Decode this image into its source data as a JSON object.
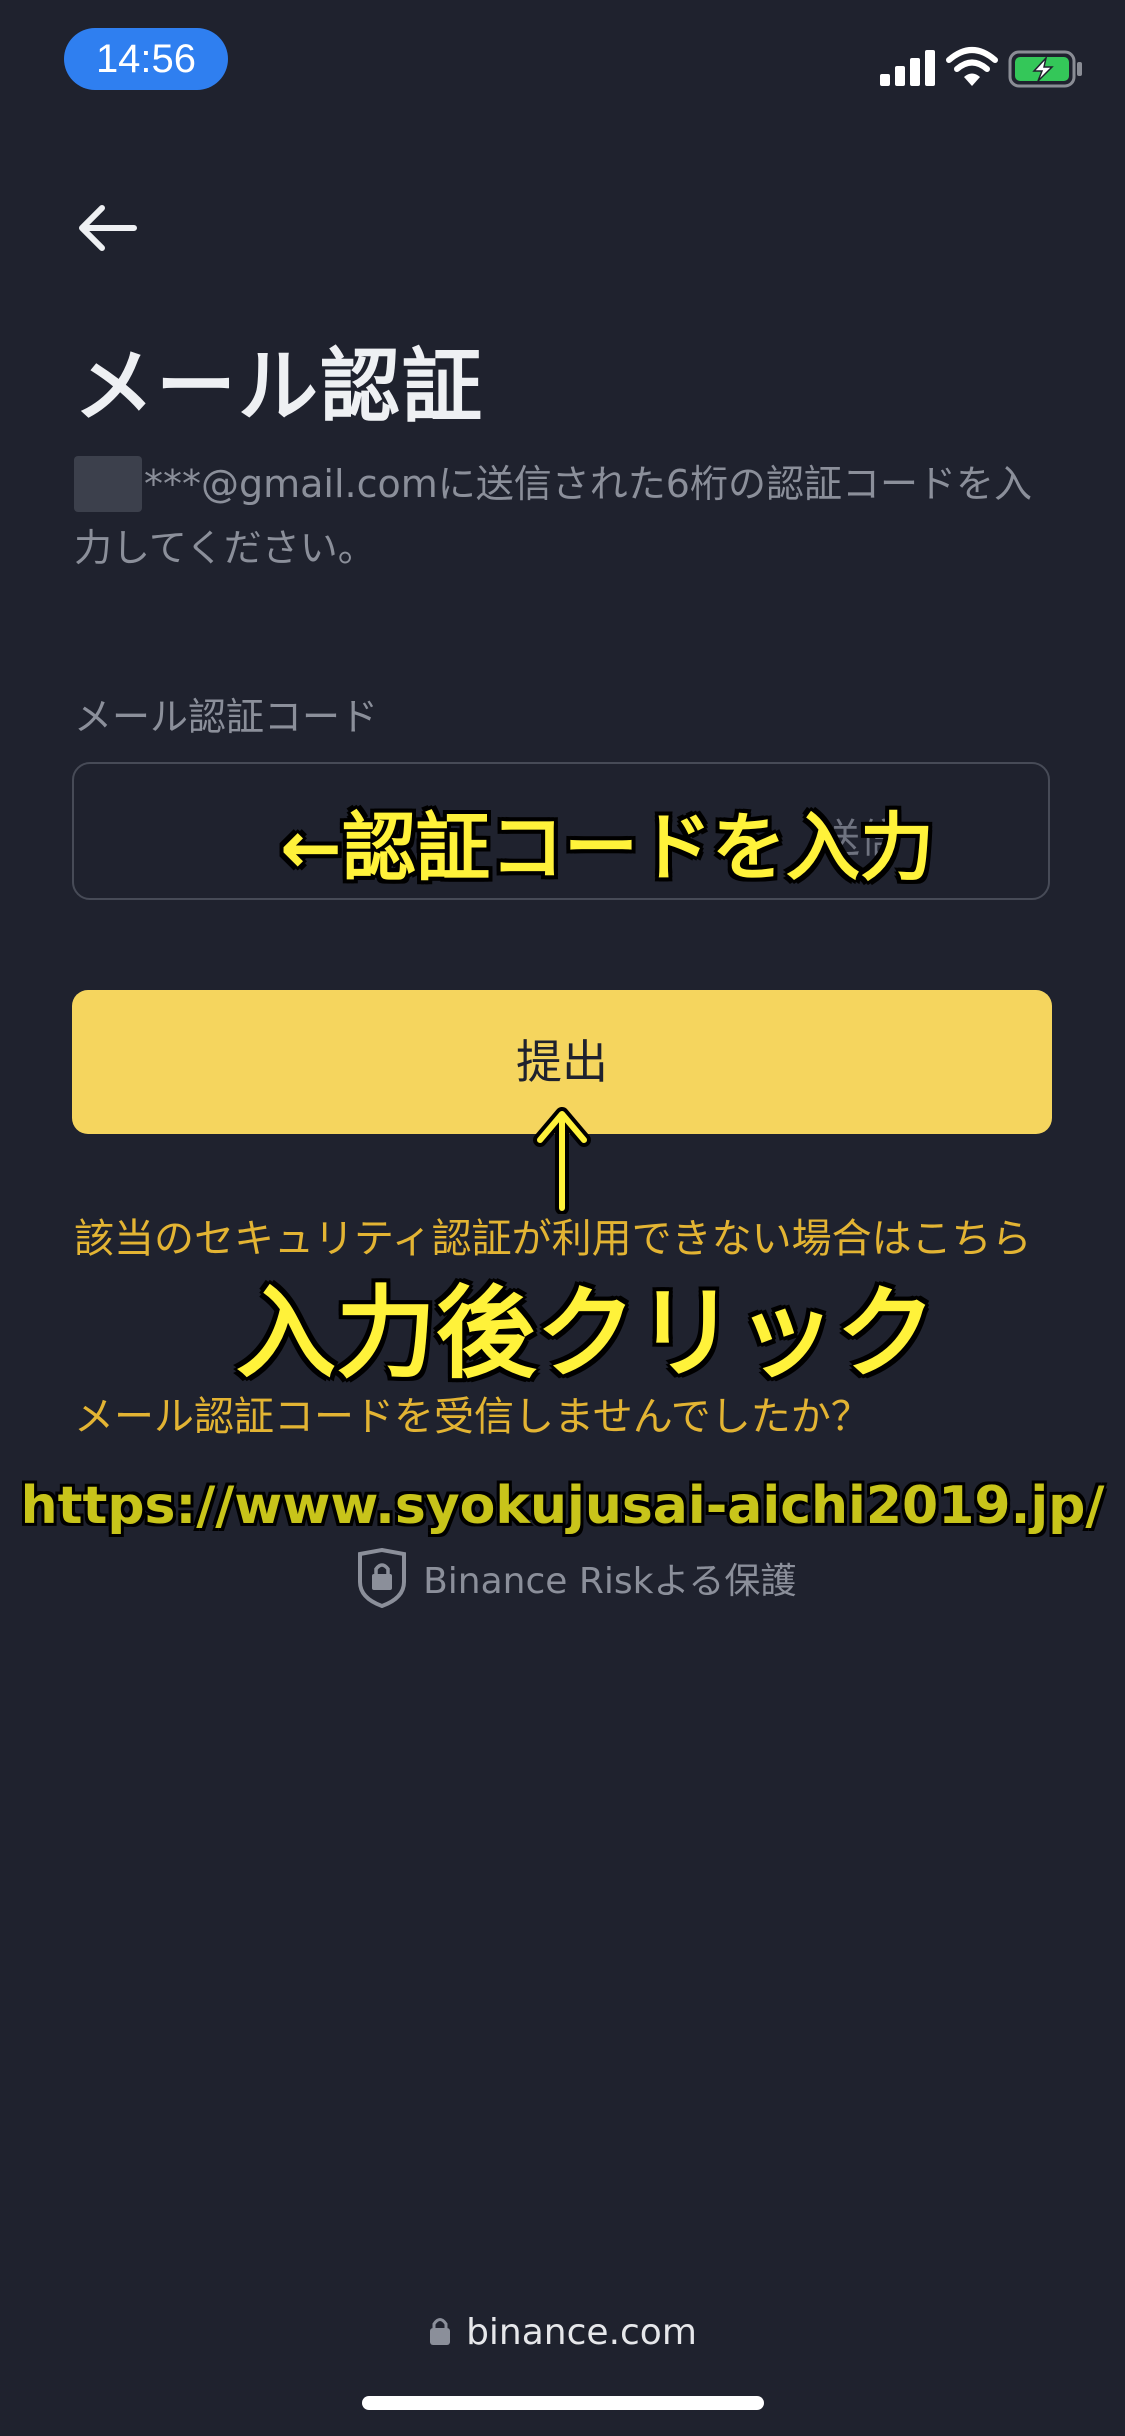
{
  "status_bar": {
    "time": "14:56"
  },
  "header": {
    "title": "メール認証"
  },
  "instruction": "***@gmail.comに送信された6桁の認証コードを入力してください。",
  "form": {
    "field_label": "メール認証コード",
    "code_value": "",
    "send_label": "送信",
    "submit_label": "提出"
  },
  "links": {
    "security_unavailable": "該当のセキュリティ認証が利用できない場合はこちら",
    "resend": "メール認証コードを受信しませんでしたか？"
  },
  "footer": {
    "protection_text": "Binance Riskよる保護",
    "url": "binance.com"
  },
  "annotations": {
    "input_hint": "←認証コードを入力",
    "click_hint": "入力後クリック",
    "arrow_up": "↑",
    "watermark_url": "https://www.syokujusai-aichi2019.jp/"
  },
  "colors": {
    "background": "#1f222e",
    "accent": "#f5d55e",
    "link": "#e3b433",
    "annotation": "#fff23a"
  },
  "icons": [
    "back-arrow-icon",
    "signal-icon",
    "wifi-icon",
    "battery-charging-icon",
    "shield-lock-icon",
    "lock-icon"
  ]
}
